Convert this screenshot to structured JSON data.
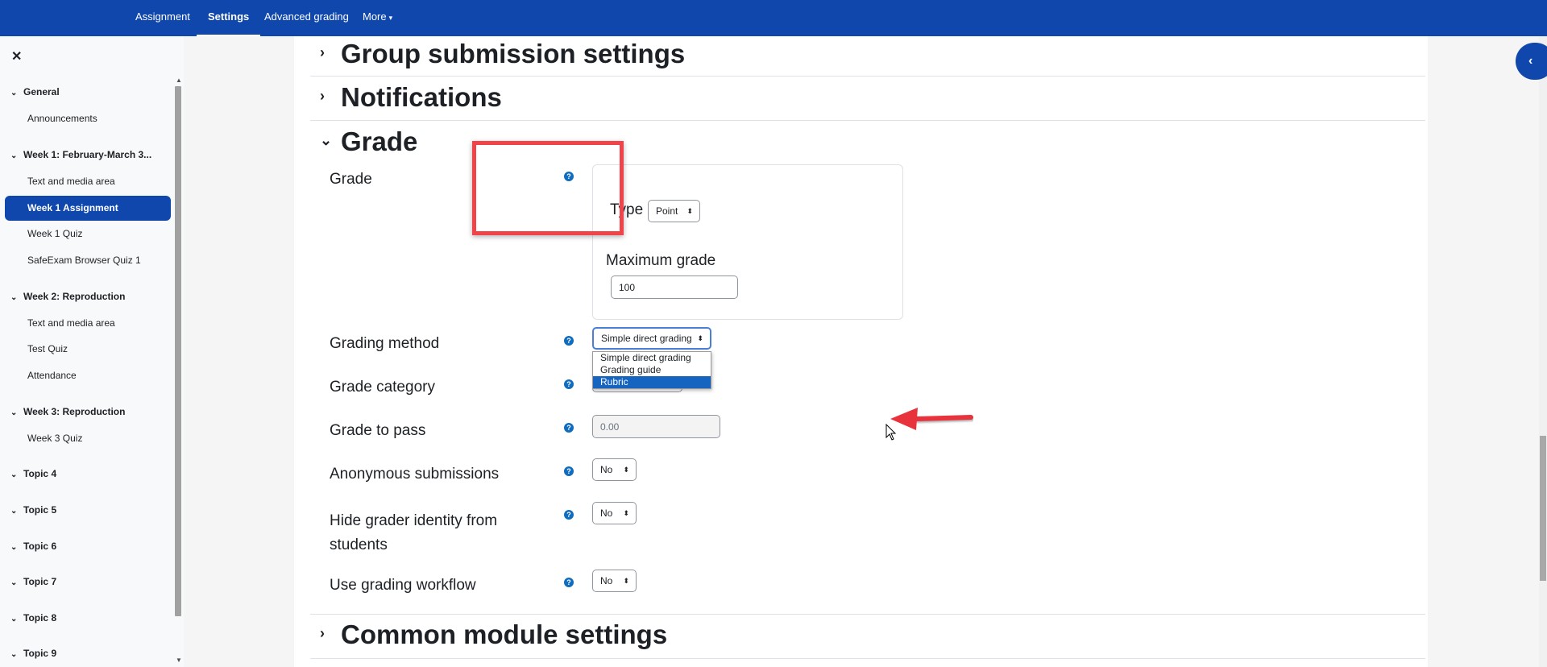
{
  "topnav": {
    "tabs": [
      {
        "label": "Assignment"
      },
      {
        "label": "Settings"
      },
      {
        "label": "Advanced grading"
      },
      {
        "label": "More"
      }
    ],
    "active_tab": "Settings"
  },
  "drawer": {
    "close_icon": "close-icon",
    "sections": [
      {
        "title": "General",
        "items": [
          "Announcements"
        ]
      },
      {
        "title": "Week 1: February-March 3...",
        "items": [
          "Text and media area",
          "Week 1 Assignment",
          "Week 1 Quiz",
          "SafeExam Browser Quiz 1"
        ]
      },
      {
        "title": "Week 2: Reproduction",
        "items": [
          "Text and media area",
          "Test Quiz",
          "Attendance"
        ]
      },
      {
        "title": "Week 3: Reproduction",
        "items": [
          "Week 3 Quiz"
        ]
      },
      {
        "title": "Topic 4",
        "items": []
      },
      {
        "title": "Topic 5",
        "items": []
      },
      {
        "title": "Topic 6",
        "items": []
      },
      {
        "title": "Topic 7",
        "items": []
      },
      {
        "title": "Topic 8",
        "items": []
      },
      {
        "title": "Topic 9",
        "items": []
      }
    ],
    "active_item": "Week 1 Assignment"
  },
  "form": {
    "headers": {
      "group_submission": "Group submission settings",
      "notifications": "Notifications",
      "grade": "Grade",
      "common_module": "Common module settings"
    },
    "grade": {
      "label": "Grade",
      "type_label": "Type",
      "type_value": "Point",
      "max_label": "Maximum grade",
      "max_value": "100"
    },
    "grading_method": {
      "label": "Grading method",
      "value": "Simple direct grading",
      "options": [
        "Simple direct grading",
        "Grading guide",
        "Rubric"
      ],
      "highlighted": "Rubric"
    },
    "grade_category": {
      "label": "Grade category"
    },
    "grade_to_pass": {
      "label": "Grade to pass",
      "value": "0.00"
    },
    "anonymous": {
      "label": "Anonymous submissions",
      "value": "No"
    },
    "hide_grader": {
      "label": "Hide grader identity from students",
      "value": "No"
    },
    "workflow": {
      "label": "Use grading workflow",
      "value": "No"
    }
  },
  "colors": {
    "brand": "#0f47ad",
    "highlight_box": "#f0434a",
    "arrow": "#e8323c",
    "option_highlight": "#1565c0"
  }
}
